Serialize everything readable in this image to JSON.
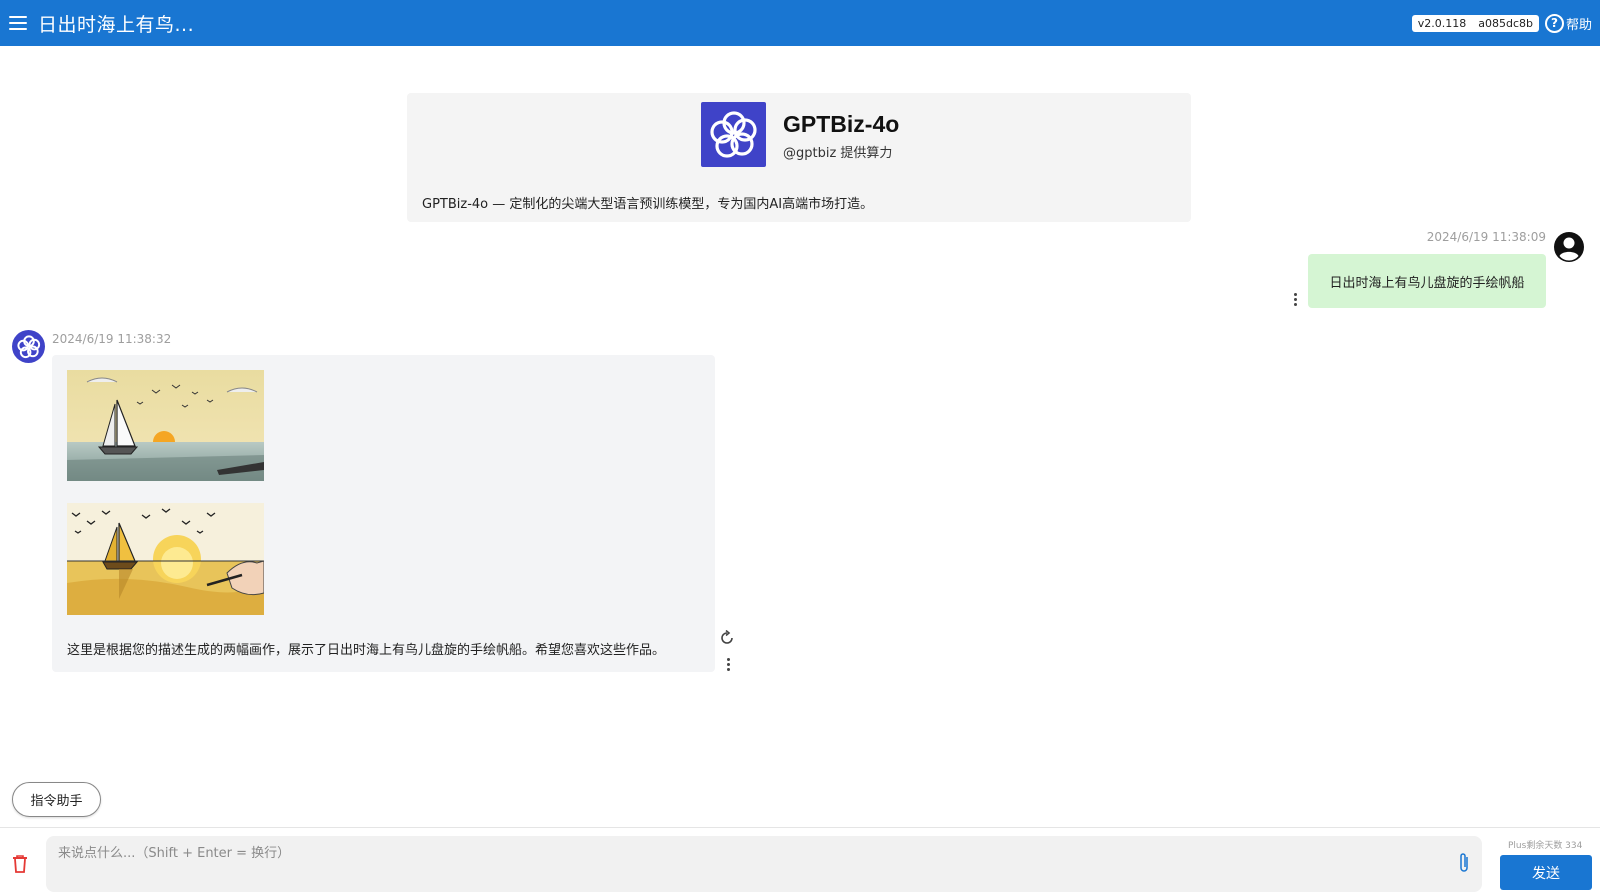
{
  "topbar": {
    "title": "日出时海上有鸟...",
    "version": "v2.0.118",
    "build": "a085dc8b",
    "help_label": "帮助"
  },
  "model": {
    "name": "GPTBiz-4o",
    "provider": "@gptbiz 提供算力",
    "description": "GPTBiz-4o — 定制化的尖端大型语言预训练模型，专为国内AI高端市场打造。"
  },
  "messages": {
    "user": {
      "timestamp": "2024/6/19 11:38:09",
      "text": "日出时海上有鸟儿盘旋的手绘帆船"
    },
    "bot": {
      "timestamp": "2024/6/19 11:38:32",
      "text": "这里是根据您的描述生成的两幅画作，展示了日出时海上有鸟儿盘旋的手绘帆船。希望您喜欢这些作品。"
    }
  },
  "command_helper_label": "指令助手",
  "input": {
    "placeholder": "来说点什么...（Shift + Enter = 换行）",
    "value": ""
  },
  "plus_days_label": "Plus剩余天数 334",
  "send_label": "发送",
  "icons": {
    "menu": "hamburger-menu-icon",
    "help": "question-circle-icon",
    "user_avatar": "account-circle-icon",
    "more": "more-vertical-icon",
    "regenerate": "refresh-icon",
    "delete": "trash-icon",
    "attach": "paperclip-icon"
  },
  "colors": {
    "primary": "#1976d2",
    "user_bubble": "#d5f5d3",
    "bot_bubble": "#f3f4f6",
    "model_logo": "#3f43c8",
    "danger": "#e53935"
  }
}
